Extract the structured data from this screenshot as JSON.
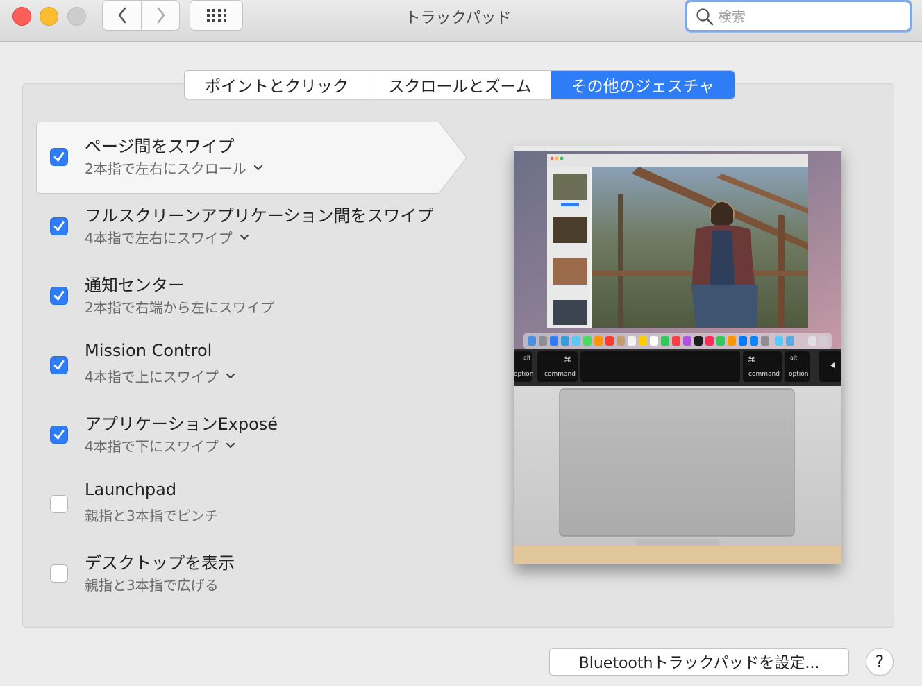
{
  "window": {
    "title": "トラックパッド"
  },
  "search": {
    "placeholder": "検索"
  },
  "tabs": [
    {
      "label": "ポイントとクリック",
      "active": false
    },
    {
      "label": "スクロールとズーム",
      "active": false
    },
    {
      "label": "その他のジェスチャ",
      "active": true
    }
  ],
  "gestures": [
    {
      "title": "ページ間をスワイプ",
      "subtitle": "2本指で左右にスクロール",
      "checked": true,
      "has_menu": true,
      "selected": true
    },
    {
      "title": "フルスクリーンアプリケーション間をスワイプ",
      "subtitle": "4本指で左右にスワイプ",
      "checked": true,
      "has_menu": true,
      "selected": false
    },
    {
      "title": "通知センター",
      "subtitle": "2本指で右端から左にスワイプ",
      "checked": true,
      "has_menu": false,
      "selected": false
    },
    {
      "title": "Mission Control",
      "subtitle": "4本指で上にスワイプ",
      "checked": true,
      "has_menu": true,
      "selected": false
    },
    {
      "title": "アプリケーションExposé",
      "subtitle": "4本指で下にスワイプ",
      "checked": true,
      "has_menu": true,
      "selected": false
    },
    {
      "title": "Launchpad",
      "subtitle": "親指と3本指でピンチ",
      "checked": false,
      "has_menu": false,
      "selected": false
    },
    {
      "title": "デスクトップを表示",
      "subtitle": "親指と3本指で広げる",
      "checked": false,
      "has_menu": false,
      "selected": false
    }
  ],
  "preview": {
    "keys": {
      "option_left": "option",
      "command_left": "command",
      "command_right": "command",
      "option_right": "option",
      "alt": "alt",
      "cmd_symbol": "⌘"
    }
  },
  "footer": {
    "bluetooth_button": "Bluetoothトラックパッドを設定...",
    "help_button": "?"
  },
  "colors": {
    "accent": "#2f7df6",
    "close": "#fc5f57",
    "minimize": "#fdbc2f",
    "zoom_disabled": "#cdcdcd"
  }
}
